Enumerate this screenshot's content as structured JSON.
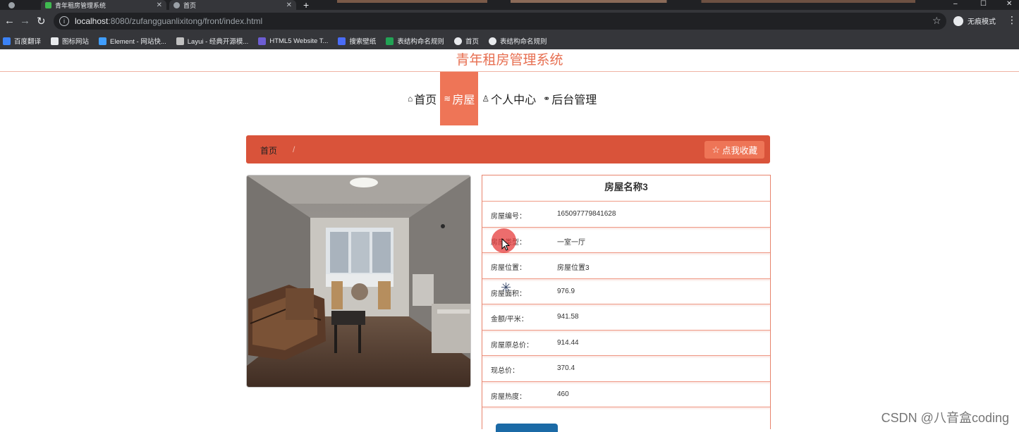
{
  "browser": {
    "tabs": [
      {
        "title": ""
      },
      {
        "title": "青年租房管理系统"
      },
      {
        "title": "首页"
      }
    ],
    "url_host": "localhost",
    "url_path": ":8080/zufangguanlixitong/front/index.html",
    "profile_label": "无痕模式",
    "bookmarks": [
      {
        "label": "百度翻译",
        "color": "#3b82f6"
      },
      {
        "label": "图标网站",
        "color": "#e8eaed"
      },
      {
        "label": "Element - 网站快...",
        "color": "#409eff"
      },
      {
        "label": "Layui - 经典开源模...",
        "color": "#c0c0c0"
      },
      {
        "label": "HTML5 Website T...",
        "color": "#6d5dd3"
      },
      {
        "label": "搜索壁纸",
        "color": "#4a6cf7"
      },
      {
        "label": "表结构命名规则",
        "color": "#22a355"
      },
      {
        "label": "首页",
        "color": "#e8eaed"
      },
      {
        "label": "表结构命名规则",
        "color": "#e8eaed"
      }
    ]
  },
  "site": {
    "title": "青年租房管理系统",
    "nav": [
      {
        "label": "首页",
        "icon": "home-icon"
      },
      {
        "label": "房屋",
        "icon": "layers-icon"
      },
      {
        "label": "个人中心",
        "icon": "user-icon"
      },
      {
        "label": "后台管理",
        "icon": "link-icon"
      }
    ],
    "breadcrumb": {
      "home": "首页",
      "separator": "/"
    },
    "favorite_button": "点我收藏"
  },
  "house": {
    "name": "房屋名称3",
    "fields": [
      {
        "label": "房屋编号：",
        "value": "165097779841628"
      },
      {
        "label": "房屋类型：",
        "value": "一室一厅"
      },
      {
        "label": "房屋位置：",
        "value": "房屋位置3"
      },
      {
        "label": "房屋面积：",
        "value": "976.9"
      },
      {
        "label": "金额/平米：",
        "value": "941.58"
      },
      {
        "label": "房屋原总价：",
        "value": "914.44"
      },
      {
        "label": "现总价：",
        "value": "370.4"
      },
      {
        "label": "房屋热度：",
        "value": "460"
      }
    ]
  },
  "watermark": "CSDN @八音盒coding",
  "colors": {
    "accent": "#ee7557",
    "title": "#e76f51",
    "crumb_bg": "#d9533a"
  }
}
